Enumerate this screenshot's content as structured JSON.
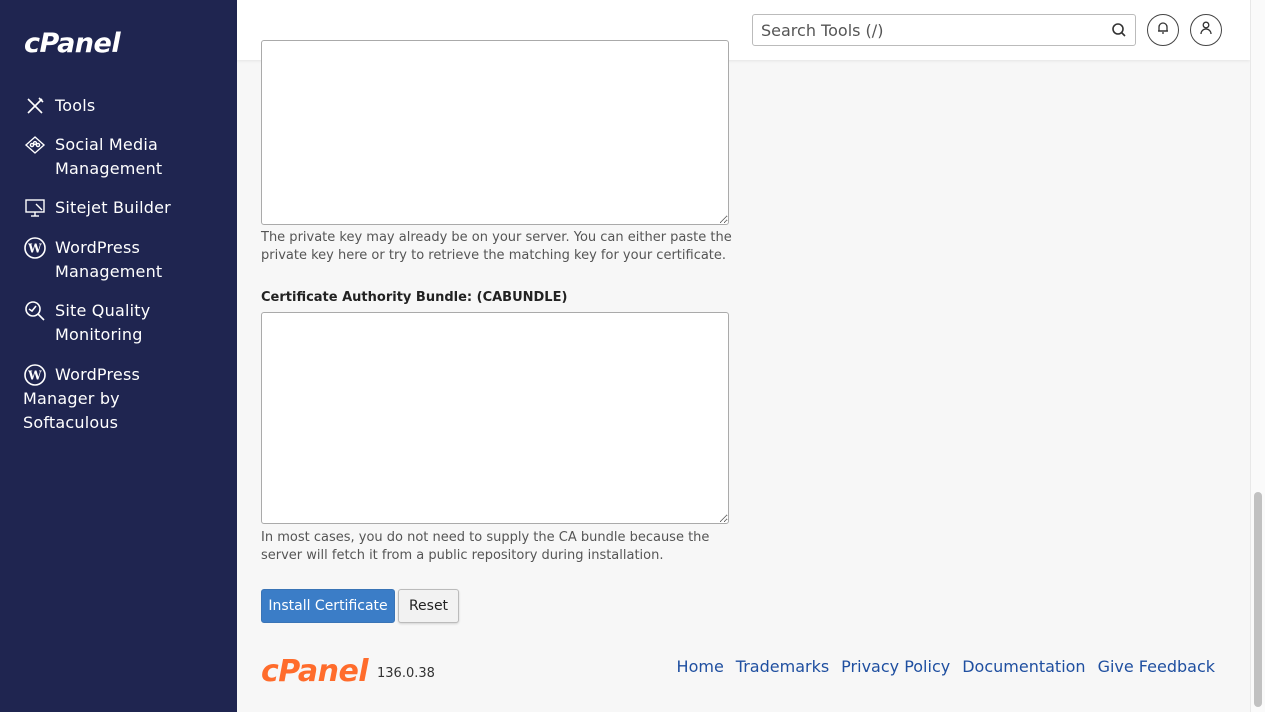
{
  "sidebar": {
    "logo": "cPanel",
    "items": [
      {
        "label": "Tools",
        "icon": "tools-icon"
      },
      {
        "label": "Social Media Management",
        "icon": "social-media-icon"
      },
      {
        "label": "Sitejet Builder",
        "icon": "sitejet-icon"
      },
      {
        "label": "WordPress Management",
        "icon": "wordpress-icon"
      },
      {
        "label": "Site Quality Monitoring",
        "icon": "site-quality-icon"
      },
      {
        "label": "WordPress Manager by Softaculous",
        "icon": "wordpress-icon"
      }
    ]
  },
  "header": {
    "search_placeholder": "Search Tools (/)"
  },
  "form": {
    "private_key_value": "",
    "private_key_help": "The private key may already be on your server. You can either paste the private key here or try to retrieve the matching key for your certificate.",
    "cabundle_label": "Certificate Authority Bundle: (CABUNDLE)",
    "cabundle_value": "",
    "cabundle_help": "In most cases, you do not need to supply the CA bundle because the server will fetch it from a public repository during installation.",
    "install_label": "Install Certificate",
    "reset_label": "Reset"
  },
  "footer": {
    "logo": "cPanel",
    "version": "136.0.38",
    "links": [
      "Home",
      "Trademarks",
      "Privacy Policy",
      "Documentation",
      "Give Feedback"
    ]
  },
  "colors": {
    "sidebar_bg": "#1f2550",
    "primary": "#3b7dc7",
    "brand_orange": "#ff6c2c",
    "link": "#1f4fa0"
  }
}
